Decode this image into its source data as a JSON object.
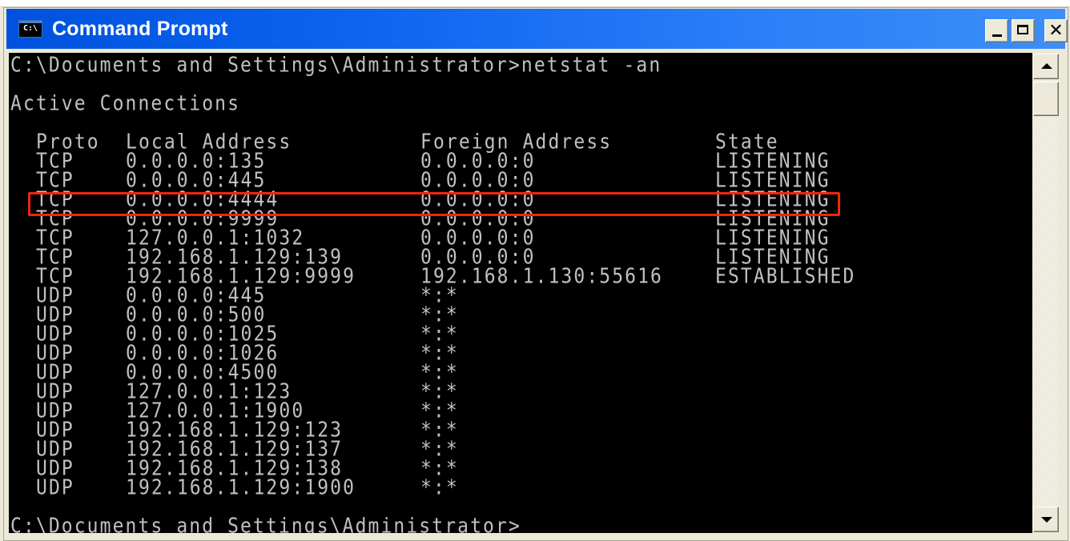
{
  "window": {
    "title": "Command Prompt",
    "icon": "console-icon",
    "icon_text": "C:\\",
    "controls": {
      "minimize": "minimize-icon",
      "maximize": "maximize-icon",
      "close_glyph": "✕"
    }
  },
  "console": {
    "command_line": "C:\\Documents and Settings\\Administrator>netstat -an",
    "section_title": "Active Connections",
    "headers": {
      "proto": "Proto",
      "local": "Local Address",
      "foreign": "Foreign Address",
      "state": "State"
    },
    "rows": [
      {
        "proto": "TCP",
        "local": "0.0.0.0:135",
        "foreign": "0.0.0.0:0",
        "state": "LISTENING"
      },
      {
        "proto": "TCP",
        "local": "0.0.0.0:445",
        "foreign": "0.0.0.0:0",
        "state": "LISTENING"
      },
      {
        "proto": "TCP",
        "local": "0.0.0.0:4444",
        "foreign": "0.0.0.0:0",
        "state": "LISTENING"
      },
      {
        "proto": "TCP",
        "local": "0.0.0.0:9999",
        "foreign": "0.0.0.0:0",
        "state": "LISTENING"
      },
      {
        "proto": "TCP",
        "local": "127.0.0.1:1032",
        "foreign": "0.0.0.0:0",
        "state": "LISTENING"
      },
      {
        "proto": "TCP",
        "local": "192.168.1.129:139",
        "foreign": "0.0.0.0:0",
        "state": "LISTENING"
      },
      {
        "proto": "TCP",
        "local": "192.168.1.129:9999",
        "foreign": "192.168.1.130:55616",
        "state": "ESTABLISHED"
      },
      {
        "proto": "UDP",
        "local": "0.0.0.0:445",
        "foreign": "*:*",
        "state": ""
      },
      {
        "proto": "UDP",
        "local": "0.0.0.0:500",
        "foreign": "*:*",
        "state": ""
      },
      {
        "proto": "UDP",
        "local": "0.0.0.0:1025",
        "foreign": "*:*",
        "state": ""
      },
      {
        "proto": "UDP",
        "local": "0.0.0.0:1026",
        "foreign": "*:*",
        "state": ""
      },
      {
        "proto": "UDP",
        "local": "0.0.0.0:4500",
        "foreign": "*:*",
        "state": ""
      },
      {
        "proto": "UDP",
        "local": "127.0.0.1:123",
        "foreign": "*:*",
        "state": ""
      },
      {
        "proto": "UDP",
        "local": "127.0.0.1:1900",
        "foreign": "*:*",
        "state": ""
      },
      {
        "proto": "UDP",
        "local": "192.168.1.129:123",
        "foreign": "*:*",
        "state": ""
      },
      {
        "proto": "UDP",
        "local": "192.168.1.129:137",
        "foreign": "*:*",
        "state": ""
      },
      {
        "proto": "UDP",
        "local": "192.168.1.129:138",
        "foreign": "*:*",
        "state": ""
      },
      {
        "proto": "UDP",
        "local": "192.168.1.129:1900",
        "foreign": "*:*",
        "state": ""
      }
    ],
    "highlighted_row_index": 2,
    "prompt_line": "C:\\Documents and Settings\\Administrator>"
  },
  "colors": {
    "console_bg": "#000000",
    "console_fg": "#c0c0c0",
    "highlight_border": "#f0260a",
    "titlebar_start": "#0052de",
    "titlebar_end": "#3c8ef9"
  }
}
